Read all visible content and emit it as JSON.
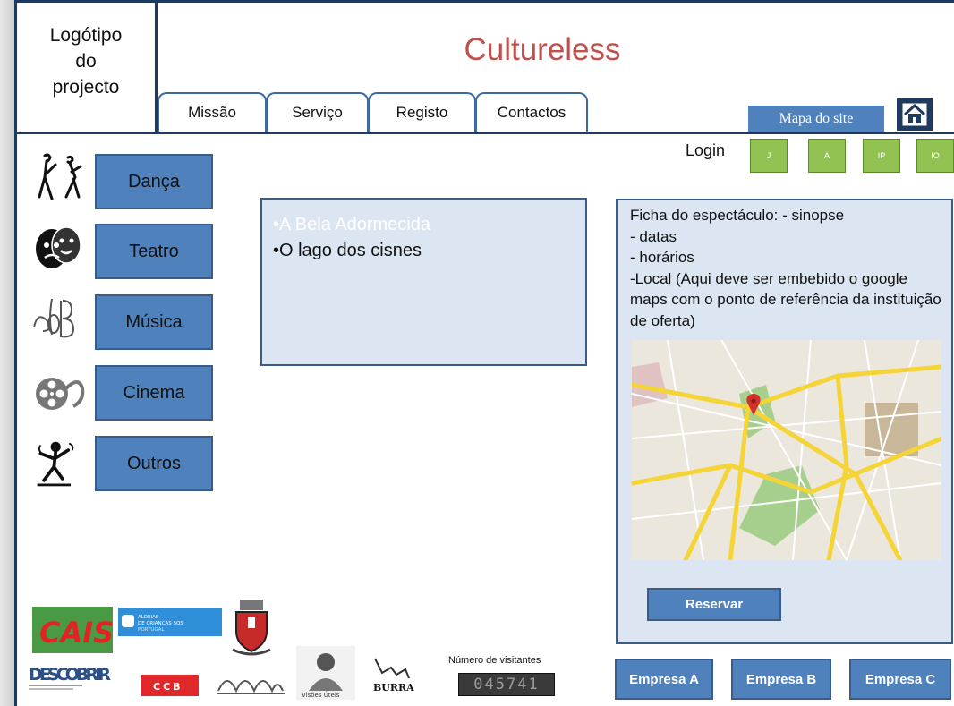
{
  "header": {
    "logo_text": "Logótipo\ndo\nprojecto",
    "site_title": "Cultureless",
    "tabs": [
      {
        "label": "Missão"
      },
      {
        "label": "Serviço"
      },
      {
        "label": "Registo"
      },
      {
        "label": "Contactos"
      }
    ],
    "sitemap_label": "Mapa do site",
    "home_icon": "home-icon"
  },
  "login": {
    "label": "Login",
    "buttons": [
      {
        "label": "J"
      },
      {
        "label": "A"
      },
      {
        "label": "IP"
      },
      {
        "label": "IO"
      }
    ]
  },
  "categories": [
    {
      "label": "Dança",
      "icon": "dancers-icon"
    },
    {
      "label": "Teatro",
      "icon": "theatre-masks-icon"
    },
    {
      "label": "Música",
      "icon": "music-icon"
    },
    {
      "label": "Cinema",
      "icon": "film-reel-icon"
    },
    {
      "label": "Outros",
      "icon": "performer-icon"
    }
  ],
  "shows": [
    {
      "label": "•A Bela Adormecida",
      "color": "#ffffff"
    },
    {
      "label": "•O lago dos cisnes",
      "color": "#111111"
    }
  ],
  "detail": {
    "lines": [
      "Ficha do espectáculo: - sinopse",
      "- datas",
      "- horários",
      "-Local (Aqui deve ser embebido o google maps com o ponto de referência da instituição de oferta)"
    ],
    "reserve_label": "Reservar"
  },
  "sponsors": {
    "logos": [
      "CAIS",
      "ALDEIAS DE CRIANÇAS SOS PORTUGAL",
      "DESCOBRIR",
      "CCB",
      "GNAD",
      "Visões Úteis",
      "BURRA"
    ],
    "visitors_label": "Número de visitantes",
    "visitors_count": "045741"
  },
  "companies": [
    {
      "label": "Empresa A"
    },
    {
      "label": "Empresa B"
    },
    {
      "label": "Empresa C"
    }
  ],
  "colors": {
    "accent": "#4f81bd",
    "border": "#385d8a",
    "title": "#c0504d",
    "panel": "#dce6f2",
    "login": "#92c352"
  }
}
